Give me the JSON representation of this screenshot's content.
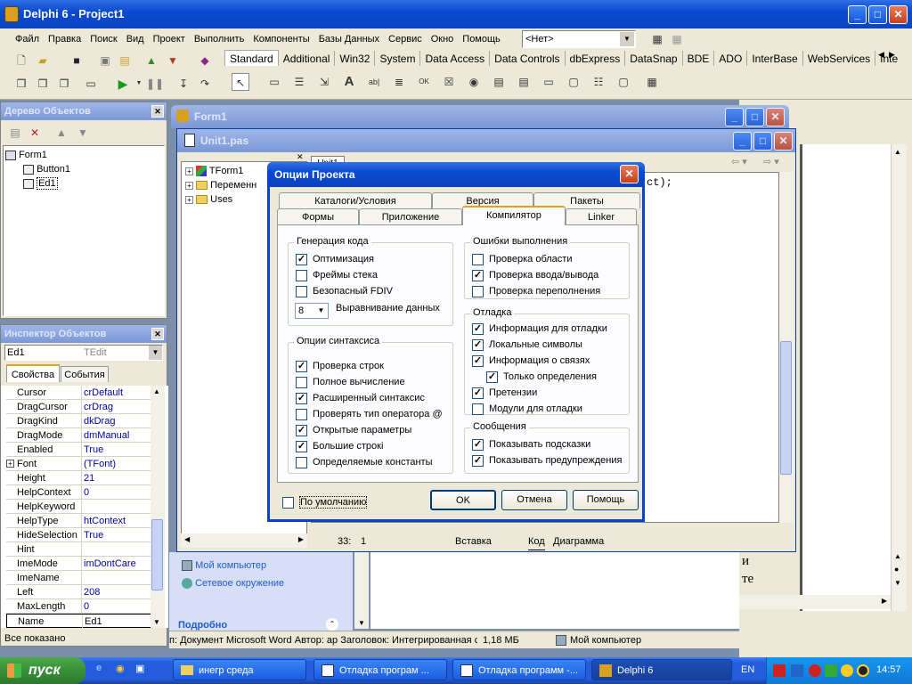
{
  "app": {
    "title": "Delphi 6 - Project1"
  },
  "menu": [
    "Файл",
    "Правка",
    "Поиск",
    "Вид",
    "Проект",
    "Выполнить",
    "Компоненты",
    "Базы Данных",
    "Сервис",
    "Окно",
    "Помощь"
  ],
  "component_combo": "<Нет>",
  "palette_tabs": [
    "Standard",
    "Additional",
    "Win32",
    "System",
    "Data Access",
    "Data Controls",
    "dbExpress",
    "DataSnap",
    "BDE",
    "ADO",
    "InterBase",
    "WebServices",
    "Internet"
  ],
  "object_tree": {
    "title": "Дерево Объектов",
    "items": [
      "Form1",
      "Button1",
      "Ed1"
    ]
  },
  "inspector": {
    "title": "Инспектор Объектов",
    "selected_name": "Ed1",
    "selected_type": "TEdit",
    "tabs": [
      "Свойства",
      "События"
    ],
    "rows": [
      {
        "k": "Cursor",
        "v": "crDefault"
      },
      {
        "k": "DragCursor",
        "v": "crDrag"
      },
      {
        "k": "DragKind",
        "v": "dkDrag"
      },
      {
        "k": "DragMode",
        "v": "dmManual"
      },
      {
        "k": "Enabled",
        "v": "True"
      },
      {
        "k": "Font",
        "v": "(TFont)"
      },
      {
        "k": "Height",
        "v": "21"
      },
      {
        "k": "HelpContext",
        "v": "0"
      },
      {
        "k": "HelpKeyword",
        "v": ""
      },
      {
        "k": "HelpType",
        "v": "htContext"
      },
      {
        "k": "HideSelection",
        "v": "True"
      },
      {
        "k": "Hint",
        "v": ""
      },
      {
        "k": "ImeMode",
        "v": "imDontCare"
      },
      {
        "k": "ImeName",
        "v": ""
      },
      {
        "k": "Left",
        "v": "208"
      },
      {
        "k": "MaxLength",
        "v": "0"
      },
      {
        "k": "Name",
        "v": "Ed1"
      }
    ],
    "status": "Все показано"
  },
  "form1": {
    "title": "Form1"
  },
  "unit1": {
    "title": "Unit1.pas",
    "tab": "Unit1",
    "tree": [
      "TForm1",
      "Переменн",
      "Uses"
    ],
    "code_tail": "ct);",
    "status_pos": "33:",
    "status_col": "1",
    "status_mode": "Вставка",
    "view_tabs": [
      "Код",
      "Диаграмма"
    ]
  },
  "explorer": {
    "items": [
      "Мой компьютер",
      "Сетевое окружение"
    ],
    "details": "Подробно"
  },
  "word_status": {
    "text": "п: Документ Microsoft Word Автор: ар Заголовок: Интегрированная с",
    "size": "1,18 МБ",
    "location": "Мой компьютер"
  },
  "dialog": {
    "title": "Опции Проекта",
    "tabs_back": [
      "Каталоги/Условия",
      "Версия",
      "Пакеты"
    ],
    "tabs_front": [
      "Формы",
      "Приложение",
      "Компилятор",
      "Linker"
    ],
    "groups": {
      "codegen": {
        "label": "Генерация кода",
        "options": [
          {
            "t": "Оптимизация",
            "c": true
          },
          {
            "t": "Фреймы стека",
            "c": false
          },
          {
            "t": "Безопасный FDIV",
            "c": false
          }
        ],
        "align_value": "8",
        "align_label": "Выравнивание данных"
      },
      "syntax": {
        "label": "Опции синтаксиса",
        "options": [
          {
            "t": "Проверка строк",
            "c": true
          },
          {
            "t": "Полное вычисление",
            "c": false
          },
          {
            "t": "Расширенный синтаксис",
            "c": true
          },
          {
            "t": "Проверять тип оператора @",
            "c": false
          },
          {
            "t": "Открытые параметры",
            "c": true
          },
          {
            "t": "Большие строкі",
            "c": true
          },
          {
            "t": "Определяемые константы",
            "c": false
          }
        ]
      },
      "runtime": {
        "label": "Ошибки выполнения",
        "options": [
          {
            "t": "Проверка области",
            "c": false
          },
          {
            "t": "Проверка ввода/вывода",
            "c": true
          },
          {
            "t": "Проверка переполнения",
            "c": false
          }
        ]
      },
      "debug": {
        "label": "Отладка",
        "options": [
          {
            "t": "Информация для отладки",
            "c": true
          },
          {
            "t": "Локальные символы",
            "c": true
          },
          {
            "t": "Информация о связях",
            "c": true
          },
          {
            "t": "Только определения",
            "c": true
          },
          {
            "t": "Претензии",
            "c": true
          },
          {
            "t": "Модули для отладки",
            "c": false
          }
        ]
      },
      "messages": {
        "label": "Сообщения",
        "options": [
          {
            "t": "Показывать подсказки",
            "c": true
          },
          {
            "t": "Показывать предупреждения",
            "c": true
          }
        ]
      }
    },
    "default_label": "По умолчанию",
    "ok": "OK",
    "cancel": "Отмена",
    "help": "Помощь"
  },
  "taskbar": {
    "start": "пуск",
    "tasks": [
      "инегр среда",
      "Отладка програм ...",
      "Отладка программ -...",
      "Delphi 6"
    ],
    "lang": "EN",
    "clock": "14:57"
  }
}
